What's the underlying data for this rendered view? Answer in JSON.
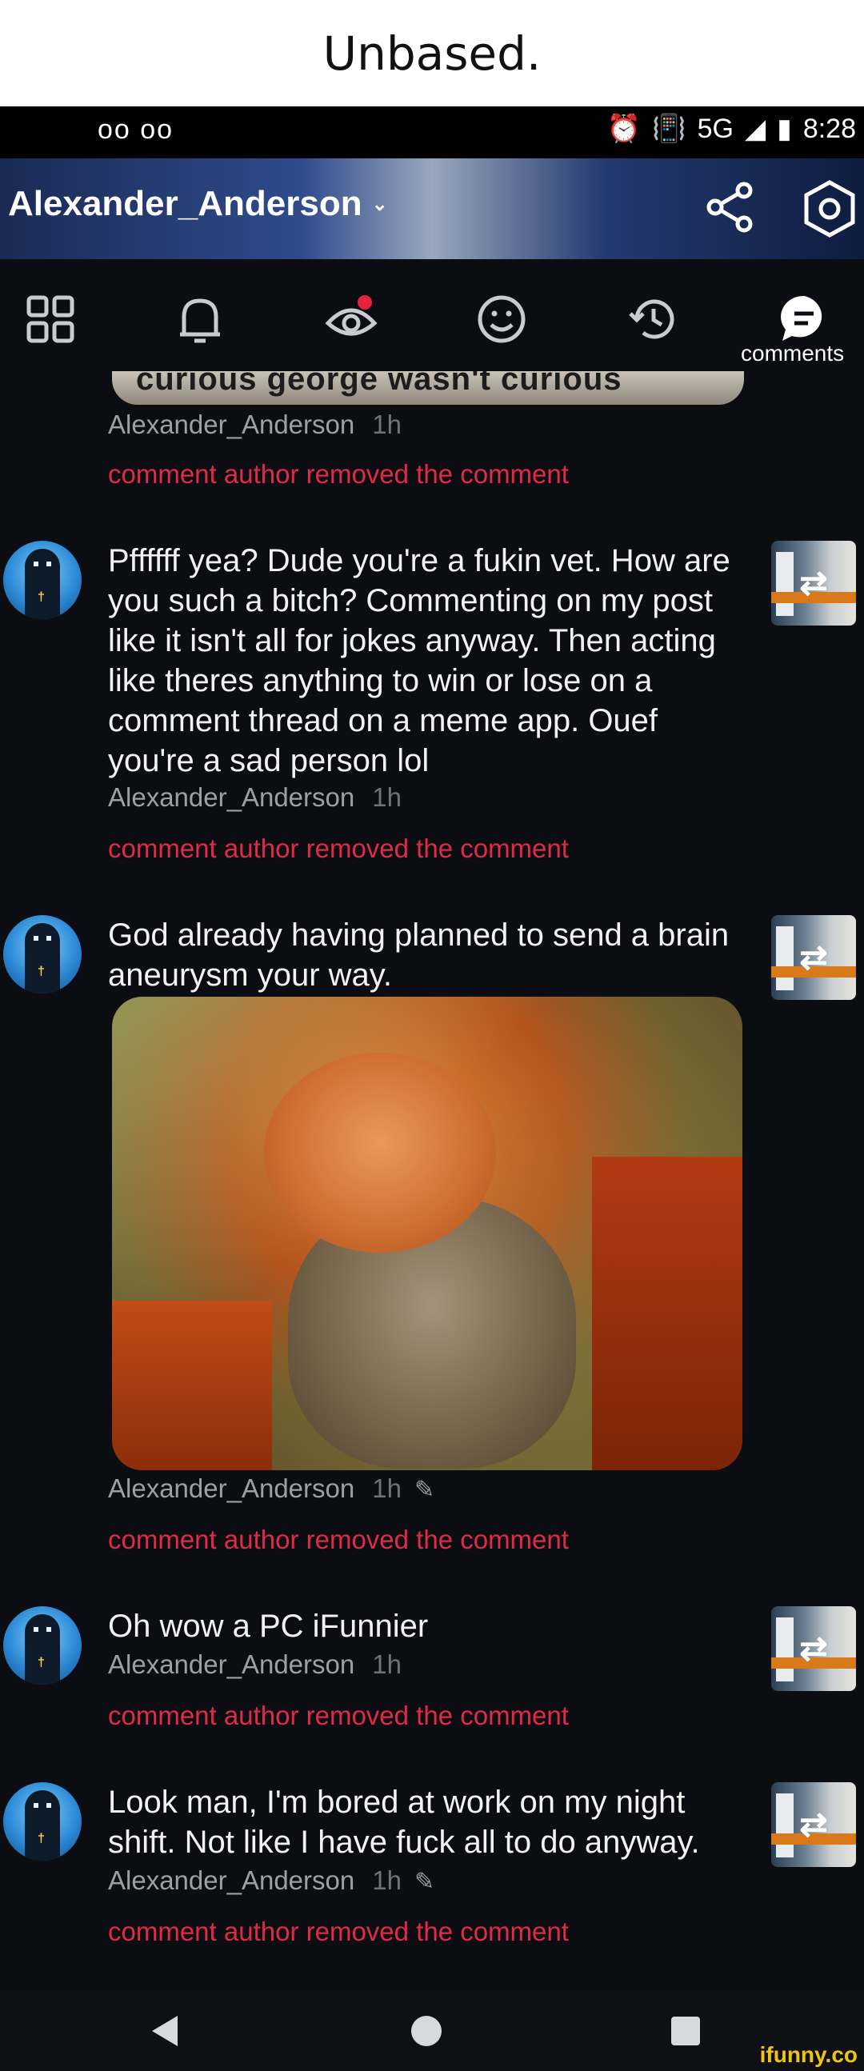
{
  "caption": "Unbased.",
  "status": {
    "voicemail": "oo oo",
    "network": "5G",
    "time": "8:28"
  },
  "header": {
    "username": "Alexander_Anderson"
  },
  "tabs": [
    {
      "icon": "grid-icon"
    },
    {
      "icon": "bell-icon"
    },
    {
      "icon": "eye-icon"
    },
    {
      "icon": "smiley-icon"
    },
    {
      "icon": "history-icon"
    },
    {
      "icon": "comments-icon",
      "label": "comments"
    }
  ],
  "cropped_caption": "curious george wasn't curious anymore",
  "comments": [
    {
      "text": "",
      "author": "Alexander_Anderson",
      "time": "1h",
      "removed": "comment author removed the comment"
    },
    {
      "text": "Pffffff yea? Dude you're a fukin vet. How are you such a bitch? Commenting on my post like it isn't all for jokes anyway. Then acting like theres anything to win or lose on a comment thread on a meme app. Ouef you're a sad person lol",
      "author": "Alexander_Anderson",
      "time": "1h",
      "removed": "comment author removed the comment"
    },
    {
      "text": "God already having planned to send a brain aneurysm your way.",
      "author": "Alexander_Anderson",
      "time": "1h",
      "removed": "comment author removed the comment"
    },
    {
      "text": "Oh wow a PC iFunnier",
      "author": "Alexander_Anderson",
      "time": "1h",
      "removed": "comment author removed the comment"
    },
    {
      "text": "Look man, I'm bored at work on my night shift. Not like I have fuck all to do anyway.",
      "author": "Alexander_Anderson",
      "time": "1h",
      "removed": "comment author removed the comment"
    }
  ],
  "watermark": "ifunny.co",
  "colors": {
    "background": "#0b0d12",
    "removed_text": "#e02a48",
    "meta_text": "#9aa0a8"
  }
}
